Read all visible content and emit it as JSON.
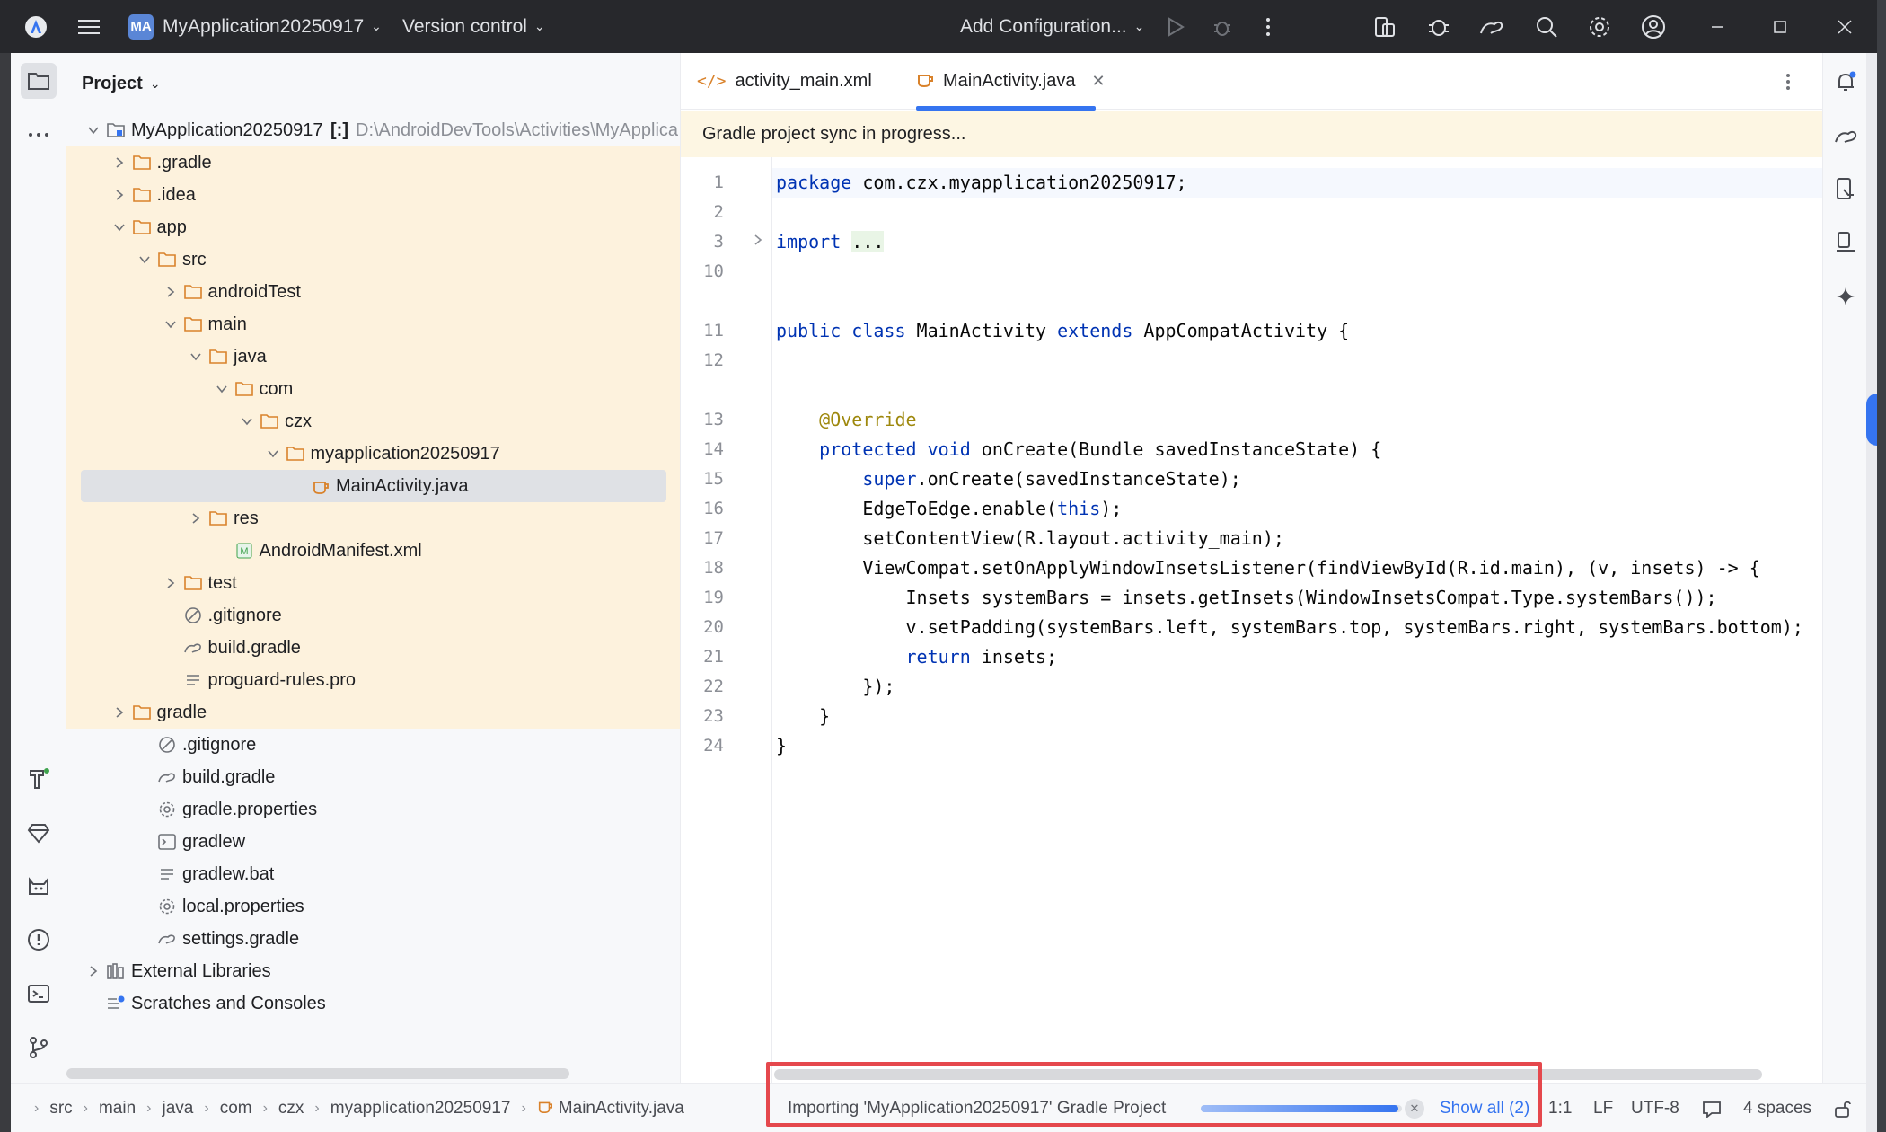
{
  "titlebar": {
    "project_badge": "MA",
    "project_name": "MyApplication20250917",
    "vcs_label": "Version control",
    "run_config": "Add Configuration..."
  },
  "project_panel": {
    "title": "Project",
    "tree": [
      {
        "label": "MyApplication20250917",
        "suffix": "[:]",
        "path": "D:\\AndroidDevTools\\Activities\\MyApplica",
        "depth": 0,
        "expanded": true,
        "icon": "module-icon"
      },
      {
        "label": ".gradle",
        "depth": 1,
        "expanded": false,
        "icon": "folder-icon"
      },
      {
        "label": ".idea",
        "depth": 1,
        "expanded": false,
        "icon": "folder-icon"
      },
      {
        "label": "app",
        "depth": 1,
        "expanded": true,
        "icon": "folder-icon"
      },
      {
        "label": "src",
        "depth": 2,
        "expanded": true,
        "icon": "folder-icon"
      },
      {
        "label": "androidTest",
        "depth": 3,
        "expanded": false,
        "icon": "folder-icon"
      },
      {
        "label": "main",
        "depth": 3,
        "expanded": true,
        "icon": "folder-icon"
      },
      {
        "label": "java",
        "depth": 4,
        "expanded": true,
        "icon": "folder-icon"
      },
      {
        "label": "com",
        "depth": 5,
        "expanded": true,
        "icon": "folder-icon"
      },
      {
        "label": "czx",
        "depth": 6,
        "expanded": true,
        "icon": "folder-icon"
      },
      {
        "label": "myapplication20250917",
        "depth": 7,
        "expanded": true,
        "icon": "folder-icon"
      },
      {
        "label": "MainActivity.java",
        "depth": 8,
        "icon": "java-class-icon",
        "selected": true
      },
      {
        "label": "res",
        "depth": 4,
        "expanded": false,
        "icon": "folder-icon"
      },
      {
        "label": "AndroidManifest.xml",
        "depth": 5,
        "icon": "manifest-icon"
      },
      {
        "label": "test",
        "depth": 3,
        "expanded": false,
        "icon": "folder-icon"
      },
      {
        "label": ".gitignore",
        "depth": 3,
        "icon": "ignore-file-icon"
      },
      {
        "label": "build.gradle",
        "depth": 3,
        "icon": "gradle-file-icon"
      },
      {
        "label": "proguard-rules.pro",
        "depth": 3,
        "icon": "text-file-icon"
      },
      {
        "label": "gradle",
        "depth": 1,
        "expanded": false,
        "icon": "folder-icon"
      },
      {
        "label": ".gitignore",
        "depth": 2,
        "icon": "ignore-file-icon"
      },
      {
        "label": "build.gradle",
        "depth": 2,
        "icon": "gradle-file-icon"
      },
      {
        "label": "gradle.properties",
        "depth": 2,
        "icon": "settings-file-icon"
      },
      {
        "label": "gradlew",
        "depth": 2,
        "icon": "terminal-file-icon"
      },
      {
        "label": "gradlew.bat",
        "depth": 2,
        "icon": "text-file-icon"
      },
      {
        "label": "local.properties",
        "depth": 2,
        "icon": "settings-file-icon"
      },
      {
        "label": "settings.gradle",
        "depth": 2,
        "icon": "gradle-file-icon"
      },
      {
        "label": "External Libraries",
        "depth": 0,
        "expanded": false,
        "icon": "libraries-icon"
      },
      {
        "label": "Scratches and Consoles",
        "depth": 0,
        "icon": "scratches-icon"
      }
    ]
  },
  "editor": {
    "tabs": [
      {
        "label": "activity_main.xml",
        "icon": "xml-icon",
        "active": false
      },
      {
        "label": "MainActivity.java",
        "icon": "java-class-icon",
        "active": true
      }
    ],
    "banner": "Gradle project sync in progress...",
    "lines": [
      {
        "n": "1",
        "tokens": [
          {
            "t": "package",
            "c": "k"
          },
          {
            "t": " com.czx.myapplication20250917;"
          }
        ]
      },
      {
        "n": "2",
        "tokens": []
      },
      {
        "n": "3",
        "tokens": [
          {
            "t": "import",
            "c": "k"
          },
          {
            "t": " "
          },
          {
            "t": "...",
            "c": "fold-box"
          }
        ],
        "fold": true
      },
      {
        "n": "10",
        "tokens": []
      },
      {
        "n": "",
        "tokens": []
      },
      {
        "n": "11",
        "tokens": [
          {
            "t": "public class",
            "c": "k"
          },
          {
            "t": " MainActivity "
          },
          {
            "t": "extends",
            "c": "k"
          },
          {
            "t": " AppCompatActivity {"
          }
        ]
      },
      {
        "n": "12",
        "tokens": []
      },
      {
        "n": "",
        "tokens": []
      },
      {
        "n": "13",
        "tokens": [
          {
            "t": "    "
          },
          {
            "t": "@Override",
            "c": "an"
          }
        ]
      },
      {
        "n": "14",
        "tokens": [
          {
            "t": "    "
          },
          {
            "t": "protected void",
            "c": "k"
          },
          {
            "t": " onCreate(Bundle savedInstanceState) {"
          }
        ]
      },
      {
        "n": "15",
        "tokens": [
          {
            "t": "        "
          },
          {
            "t": "super",
            "c": "k"
          },
          {
            "t": ".onCreate(savedInstanceState);"
          }
        ]
      },
      {
        "n": "16",
        "tokens": [
          {
            "t": "        EdgeToEdge.enable("
          },
          {
            "t": "this",
            "c": "k"
          },
          {
            "t": ");"
          }
        ]
      },
      {
        "n": "17",
        "tokens": [
          {
            "t": "        setContentView(R.layout.activity_main);"
          }
        ]
      },
      {
        "n": "18",
        "tokens": [
          {
            "t": "        ViewCompat.setOnApplyWindowInsetsListener(findViewById(R.id.main), (v, insets) -> {"
          }
        ]
      },
      {
        "n": "19",
        "tokens": [
          {
            "t": "            Insets systemBars = insets.getInsets(WindowInsetsCompat.Type.systemBars());"
          }
        ]
      },
      {
        "n": "20",
        "tokens": [
          {
            "t": "            v.setPadding(systemBars.left, systemBars.top, systemBars.right, systemBars.bottom);"
          }
        ]
      },
      {
        "n": "21",
        "tokens": [
          {
            "t": "            "
          },
          {
            "t": "return",
            "c": "k"
          },
          {
            "t": " insets;"
          }
        ]
      },
      {
        "n": "22",
        "tokens": [
          {
            "t": "        });"
          }
        ]
      },
      {
        "n": "23",
        "tokens": [
          {
            "t": "    }"
          }
        ]
      },
      {
        "n": "24",
        "tokens": [
          {
            "t": "}"
          }
        ]
      }
    ]
  },
  "statusbar": {
    "breadcrumbs": [
      "src",
      "main",
      "java",
      "com",
      "czx",
      "myapplication20250917",
      "MainActivity.java"
    ],
    "progress_text": "Importing 'MyApplication20250917' Gradle Project",
    "progress_fraction": 0.98,
    "show_all": "Show all (2)",
    "position": "1:1",
    "line_sep": "LF",
    "encoding": "UTF-8",
    "indent": "4 spaces"
  },
  "colors": {
    "accent": "#3574f0",
    "highlight_box": "#e5484d",
    "tree_yellow": "#fdf2dd"
  }
}
